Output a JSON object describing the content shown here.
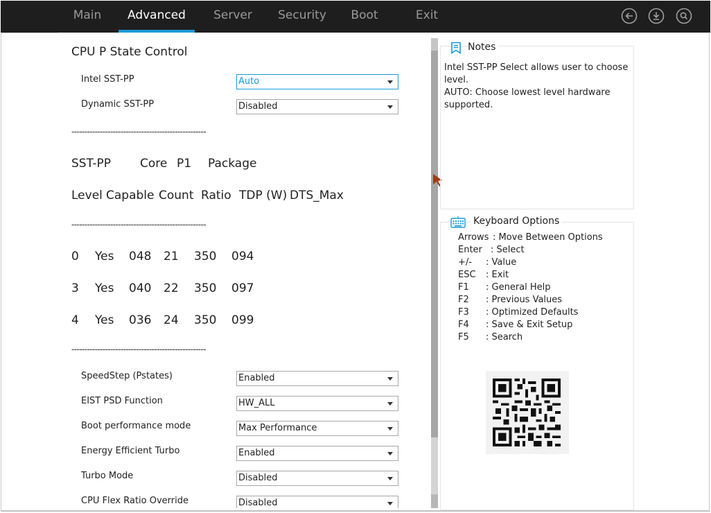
{
  "top_nav": {
    "tabs": [
      {
        "label": "Main"
      },
      {
        "label": "Advanced"
      },
      {
        "label": "Server"
      },
      {
        "label": "Security"
      },
      {
        "label": "Boot"
      },
      {
        "label": "Exit"
      }
    ],
    "active_tab": "Advanced",
    "icons": [
      "back-circle-icon",
      "download-circle-icon",
      "search-circle-icon"
    ]
  },
  "main": {
    "section_title": "CPU P State Control",
    "settings_top": [
      {
        "label": "Intel SST-PP",
        "value": "Auto",
        "focused": true
      },
      {
        "label": "Dynamic SST-PP",
        "value": "Disabled",
        "focused": false
      }
    ],
    "separator": "----------------------------------------------------",
    "table_header_1": [
      "SST-PP",
      "Core",
      "P1",
      "Package"
    ],
    "table_header_2": [
      "Level",
      "Capable",
      "Count",
      "Ratio",
      "TDP (W)",
      "DTS_Max"
    ],
    "table_rows": [
      [
        "0",
        "Yes",
        "048",
        "21",
        "350",
        "094"
      ],
      [
        "3",
        "Yes",
        "040",
        "22",
        "350",
        "097"
      ],
      [
        "4",
        "Yes",
        "036",
        "24",
        "350",
        "099"
      ]
    ],
    "settings_bottom": [
      {
        "label": "SpeedStep (Pstates)",
        "value": "Enabled"
      },
      {
        "label": "EIST PSD Function",
        "value": "HW_ALL"
      },
      {
        "label": "Boot performance mode",
        "value": "Max Performance"
      },
      {
        "label": "Energy Efficient Turbo",
        "value": "Enabled"
      },
      {
        "label": "Turbo Mode",
        "value": "Disabled"
      },
      {
        "label": "CPU Flex Ratio Override",
        "value": "Disabled"
      }
    ]
  },
  "notes": {
    "title": "Notes",
    "line1": "Intel SST-PP Select allows user to choose level.",
    "line2": "AUTO: Choose lowest level hardware supported."
  },
  "keyboard": {
    "title": "Keyboard Options",
    "options": [
      {
        "key": "Arrows",
        "desc": ": Move Between Options"
      },
      {
        "key": "Enter",
        "desc": ": Select"
      },
      {
        "key": "+/-",
        "desc": ": Value"
      },
      {
        "key": "ESC",
        "desc": ": Exit"
      },
      {
        "key": "F1",
        "desc": ": General Help"
      },
      {
        "key": "F2",
        "desc": ": Previous Values"
      },
      {
        "key": "F3",
        "desc": ": Optimized Defaults"
      },
      {
        "key": "F4",
        "desc": ": Save & Exit Setup"
      },
      {
        "key": "F5",
        "desc": ": Search"
      }
    ]
  },
  "colors": {
    "accent": "#1a9ad6",
    "topbar": "#1e1e1e",
    "scrollbar": "#a6a6a6"
  }
}
